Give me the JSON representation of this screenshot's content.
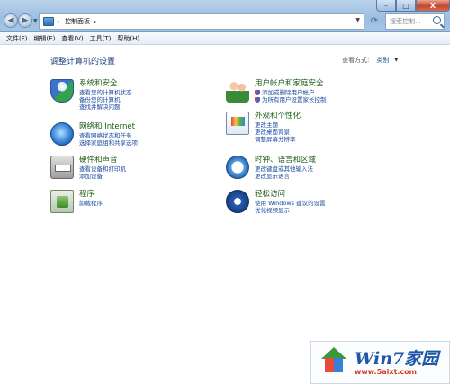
{
  "window": {
    "address_breadcrumb": "控制面板",
    "search_placeholder": "搜索控制...",
    "controls": {
      "minimize": "–",
      "maximize": "□",
      "close": "X"
    }
  },
  "menu": [
    "文件(F)",
    "编辑(E)",
    "查看(V)",
    "工具(T)",
    "帮助(H)"
  ],
  "main": {
    "title": "调整计算机的设置",
    "view_by_label": "查看方式:",
    "view_by_value": "类别"
  },
  "categories": [
    {
      "title": "系统和安全",
      "links": [
        "查看您的计算机状态",
        "备份您的计算机",
        "查找并解决问题"
      ]
    },
    {
      "title": "网络和 Internet",
      "links": [
        "查看网络状态和任务",
        "选择家庭组和共享选项"
      ]
    },
    {
      "title": "硬件和声音",
      "links": [
        "查看设备和打印机",
        "添加设备"
      ]
    },
    {
      "title": "程序",
      "links": [
        "卸载程序"
      ]
    },
    {
      "title": "用户帐户和家庭安全",
      "links": [
        "添加或删除用户帐户",
        "为所有用户设置家长控制"
      ]
    },
    {
      "title": "外观和个性化",
      "links": [
        "更改主题",
        "更改桌面背景",
        "调整屏幕分辨率"
      ]
    },
    {
      "title": "时钟、语言和区域",
      "links": [
        "更改键盘或其他输入法",
        "更改显示语言"
      ]
    },
    {
      "title": "轻松访问",
      "links": [
        "使用 Windows 建议的设置",
        "优化视频显示"
      ]
    }
  ],
  "watermark": {
    "brand": "Win7家园",
    "url": "www.5aixt.com"
  }
}
